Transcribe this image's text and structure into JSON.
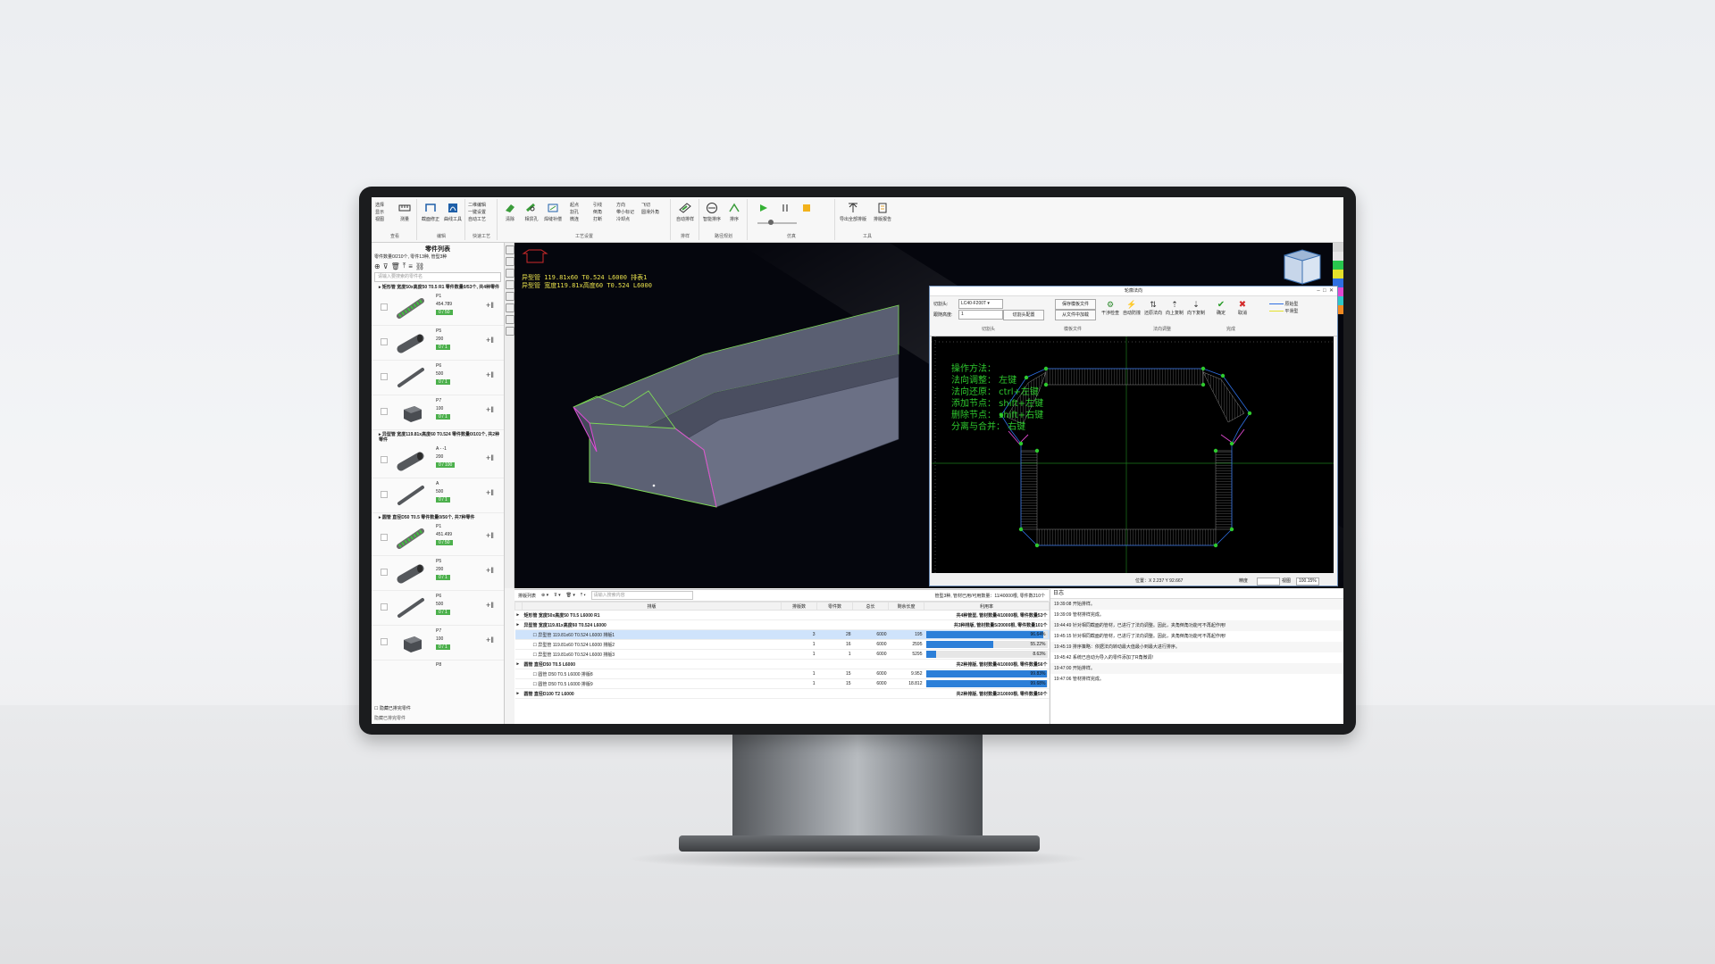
{
  "ribbon": {
    "view_items": [
      "选择",
      "显示",
      "视图"
    ],
    "measure": "测量",
    "group_view": "查看",
    "edit_buttons": [
      "截面修正",
      "曲线工具"
    ],
    "group_edit": "编辑",
    "quick_items": [
      "二维编辑",
      "一键设置",
      "自动工艺"
    ],
    "group_quick": "快速工艺",
    "process_buttons": [
      "清除",
      "相贯孔",
      "焊缝补偿"
    ],
    "process_small": [
      "起点",
      "引线",
      "方向",
      "飞切",
      "割孔",
      "倒角",
      "带小标记",
      "圆滑外角",
      "微连",
      "打断",
      "冷却点"
    ],
    "group_process": "工艺设置",
    "nest_button": "自动排样",
    "group_nest": "排样",
    "path_buttons": [
      "智能排序",
      "排序"
    ],
    "group_path": "路径规划",
    "group_sim": "仿真",
    "tool_buttons": [
      "导出全部排版",
      "排版报告"
    ],
    "group_tools": "工具"
  },
  "left": {
    "title": "零件列表",
    "summary": "零件数量0/210个, 零件13种, 管型3种",
    "search_placeholder": "请输入要搜索的零件名",
    "groups": [
      {
        "head": "矩形管 宽度50x高度50 T0.5 R1 零件数量0/53个, 共4种零件",
        "parts": [
          {
            "name": "P1",
            "length": "454.789",
            "count": "0 / 50",
            "shape": "twist"
          },
          {
            "name": "P5",
            "length": "200",
            "count": "0 / 1",
            "shape": "round"
          },
          {
            "name": "P6",
            "length": "500",
            "count": "0 / 1",
            "shape": "thin"
          },
          {
            "name": "P7",
            "length": "100",
            "count": "0 / 1",
            "shape": "square"
          }
        ]
      },
      {
        "head": "异型管 宽度119.81x高度60 T0.524 零件数量0/101个, 共2种零件",
        "parts": [
          {
            "name": "A - -1",
            "length": "200",
            "count": "0 / 100",
            "shape": "round"
          },
          {
            "name": "A",
            "length": "500",
            "count": "0 / 1",
            "shape": "thin"
          }
        ]
      },
      {
        "head": "圆管 直径D50 T0.5 零件数量0/56个, 共7种零件",
        "parts": [
          {
            "name": "P1",
            "length": "451.499",
            "count": "0 / 50",
            "shape": "twist"
          },
          {
            "name": "P5",
            "length": "200",
            "count": "0 / 1",
            "shape": "round"
          },
          {
            "name": "P6",
            "length": "500",
            "count": "0 / 1",
            "shape": "thin"
          },
          {
            "name": "P7",
            "length": "100",
            "count": "0 / 1",
            "shape": "square"
          }
        ]
      }
    ],
    "next_part": "P8",
    "hide_label": "隐藏已排完零件",
    "bottom_label": "隐藏已排完零件"
  },
  "viewport": {
    "line1": "异型管 119.81x60 T0.524 L6000 排表1",
    "line2": "异型管 宽度119.81x高度60 T0.524 L6000"
  },
  "dialog": {
    "title": "轮廓法向",
    "cutter_label": "切割头:",
    "cutter_value": "LC40-F200T",
    "height_label": "跟随高度:",
    "height_value": "1",
    "group_cutter": "切割头",
    "btn_save_template": "保存模板文件",
    "btn_cut_config": "切割头配置",
    "btn_load_template": "从文件中加载",
    "group_template": "模板文件",
    "icons": [
      "干涉检查",
      "自动防撞",
      "还原法向",
      "向上复制",
      "向下复制"
    ],
    "group_normal": "法向调整",
    "ok": "确定",
    "cancel": "取消",
    "group_done": "完成",
    "legend": [
      "原始型",
      "平滑型"
    ],
    "ops": [
      "操作方法：",
      "法向调整：  左键",
      "法向还原：  ctrl+左键",
      "添加节点：  shift+左键",
      "删除节点：  shift+右键",
      "分离与合并：  右键"
    ],
    "status_pos": "位置：X 2.237 Y 92.667",
    "status_step_label": "精度",
    "status_view_label": "视图",
    "status_view_value": "100.15%"
  },
  "nest": {
    "tab": "排版列表",
    "search_placeholder": "请输入搜索内容",
    "stats": "管型3种, 管材已用/可用数量：11/40000根, 零件数210个",
    "headers": [
      "排版",
      "排版数",
      "零件数",
      "总长",
      "剩余长度",
      "利用率"
    ],
    "groups": [
      {
        "name": "矩形管 宽度50x高度50 T0.5 L6000 R1",
        "summary": "共4种管型, 管材数量4/10000根, 零件数量53个",
        "rows": []
      },
      {
        "name": "异型管 宽度119.81x高度60 T0.524 L6000",
        "summary": "共3种排版, 管材数量5/20000根, 零件数量101个",
        "rows": [
          {
            "name": "异型管 119.81x60 T0.524 L6000 排版1",
            "count": "3",
            "parts": "28",
            "total": "6000",
            "remain": "195",
            "util": 96.64,
            "util_label": "96.64%",
            "selected": true
          },
          {
            "name": "异型管 119.81x60 T0.524 L6000 排版2",
            "count": "1",
            "parts": "16",
            "total": "6000",
            "remain": "2595",
            "util": 55.22,
            "util_label": "55.22%",
            "selected": false
          },
          {
            "name": "异型管 119.81x60 T0.524 L6000 排版3",
            "count": "1",
            "parts": "1",
            "total": "6000",
            "remain": "5295",
            "util": 8.63,
            "util_label": "8.63%",
            "selected": false
          }
        ]
      },
      {
        "name": "圆管 直径D50 T0.5 L6000",
        "summary": "共2种排版, 管材数量4/10000根, 零件数量56个",
        "rows": [
          {
            "name": "圆管 D50 T0.5 L6000 排版8",
            "count": "1",
            "parts": "15",
            "total": "6000",
            "remain": "9.952",
            "util": 99.83,
            "util_label": "99.83%",
            "selected": false
          },
          {
            "name": "圆管 D50 T0.5 L6000 排版9",
            "count": "1",
            "parts": "15",
            "total": "6000",
            "remain": "18.812",
            "util": 99.68,
            "util_label": "99.68%",
            "selected": false
          }
        ]
      },
      {
        "name": "圆管 直径D100 T2 L6000",
        "summary": "共2种排版, 管材数量2/10000根, 零件数量50个",
        "rows": []
      }
    ]
  },
  "log": {
    "title": "日志",
    "entries": [
      "19:39:08  开始排样。",
      "19:39:09  管材排样完成。",
      "19:44:49  针对相同截面的管材，已进行了法向调整。因此，夹角倒角功能可不再起作用!",
      "19:45:15  针对相同截面的管材，已进行了法向调整。因此，夹角倒角功能可不再起作用!",
      "19:45:19  排序策略：依据法向转动最大值最小到最大进行排序。",
      "19:45:42  系统已自动为导入的零件添加了R角微调!",
      "19:47:00  开始排样。",
      "19:47:06  管材排样完成。"
    ]
  },
  "colors": {
    "accent": "#2c7fd8",
    "green": "#2ec92e",
    "viewport_bg": "#05060d",
    "part_green": "#4cb04c"
  }
}
